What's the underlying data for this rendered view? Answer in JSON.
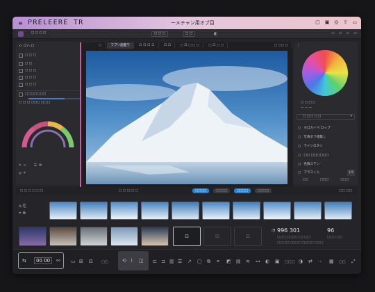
{
  "titlebar": {
    "app_name": "PRELEERE TR",
    "document": "ーメテャン用オブ目",
    "accent": "#b78fd4"
  },
  "menubar": {
    "items": [
      "□ □ □ □",
      "□ □ □",
      "□ □"
    ]
  },
  "left_panel": {
    "header": "ロハ ロ",
    "rows": [
      "□ □ □",
      "□ □",
      "□ □ □",
      "□ □ □",
      "□ □ □",
      "□ □ □"
    ],
    "section": "□□□□□□□",
    "section_sub": "□ □ □ □□□ □□□"
  },
  "canvas": {
    "tabs": [
      "フブリ画面ワ",
      "ロ ロ ロ ロ",
      "ロ ロ",
      "□ ロ □ □ □",
      "□ ロ □ □"
    ],
    "tab_right": "□ □□ □"
  },
  "right_panel": {
    "color_label": "□ □ □ □",
    "sub_label": "ー ー ー",
    "dropdown": "□ □ □ □ □",
    "options": [
      "ホロカイペ ロップ",
      "写真ダフ相集し",
      "ラインロタン",
      "□□ □□□□□□",
      "名数ステン",
      "ブラスく入",
      "1/5"
    ],
    "footer": [
      "□□",
      "□□□",
      "□□□"
    ]
  },
  "status": {
    "left": "□ □ □ □ □ □",
    "mid": "□ □ □ □ □",
    "chips": [
      "□□□□",
      "□□□□",
      "□□□□",
      "□□□□"
    ],
    "right": "□□ □□"
  },
  "info": {
    "time": "996 301",
    "time_right": "96",
    "meta1": "□□□ □□□□ □□□□",
    "meta2": "□□□ □□",
    "meta3": "□□□□ □□□□ □□□□ □□□"
  },
  "bottom": {
    "counter": "00 00",
    "labels": [
      "□□",
      "□□□",
      "□□"
    ]
  }
}
